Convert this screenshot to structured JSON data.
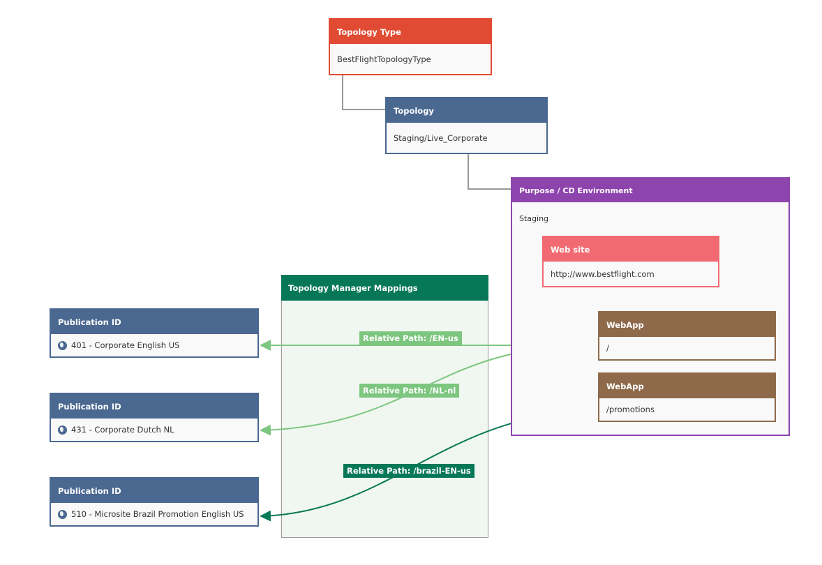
{
  "topology_type": {
    "header": "Topology Type",
    "value": "BestFlightTopologyType",
    "color": "#e24b33"
  },
  "topology": {
    "header": "Topology",
    "value": "Staging/Live_Corporate",
    "color": "#4a6890"
  },
  "purpose": {
    "header": "Purpose / CD Environment",
    "value": "Staging",
    "color": "#8e44ad"
  },
  "website": {
    "header": "Web site",
    "value": "http://www.bestflight.com",
    "color": "#f16a72"
  },
  "webapps": [
    {
      "header": "WebApp",
      "value": "/"
    },
    {
      "header": "WebApp",
      "value": "/promotions"
    }
  ],
  "mappings": {
    "header": "Topology Manager Mappings",
    "color": "#077857"
  },
  "publications": [
    {
      "header": "Publication ID",
      "value": "401 - Corporate English US",
      "icon": "globe-icon"
    },
    {
      "header": "Publication ID",
      "value": "431 - Corporate Dutch NL",
      "icon": "globe-icon"
    },
    {
      "header": "Publication ID",
      "value": "510 - Microsite Brazil Promotion English US",
      "icon": "globe-icon"
    }
  ],
  "paths": [
    {
      "label": "Relative Path: /EN-us",
      "color": "#7dc67f"
    },
    {
      "label": "Relative Path: /NL-nl",
      "color": "#7dc67f"
    },
    {
      "label": "Relative Path: /brazil-EN-us",
      "color": "#077857"
    }
  ]
}
